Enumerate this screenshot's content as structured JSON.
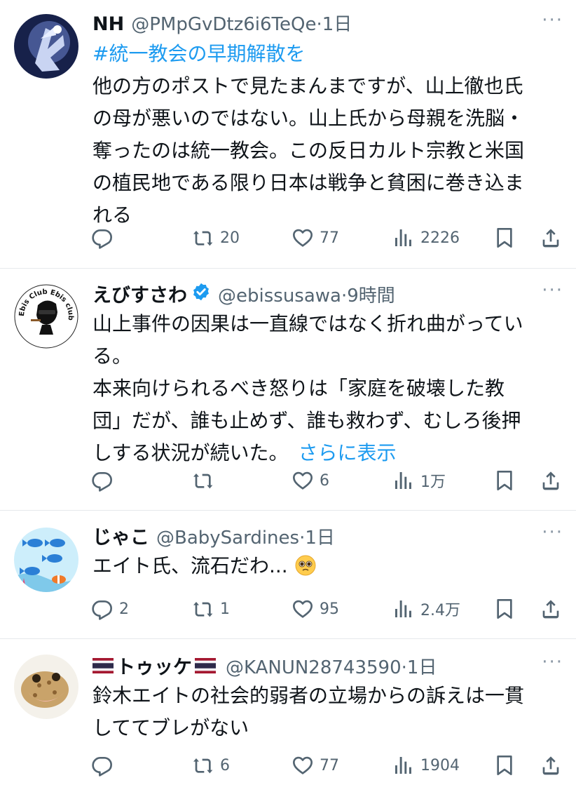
{
  "posts": [
    {
      "name": "NH",
      "handle": "@PMpGvDtz6i6TeQe",
      "dot": "·",
      "time": "1日",
      "hashtag": "#統一教会の早期解散を",
      "lines": [
        "他の方のポストで見たまんまですが、山上徹也氏",
        "の母が悪いのではない。山上氏から母親を洗脳・",
        "奪ったのは統一教会。この反日カルト宗教と米国",
        "の植民地である限り日本は戦争と貧困に巻き込ま",
        "れる"
      ],
      "replies": "",
      "reposts": "20",
      "likes": "77",
      "views": "2226",
      "more": "···"
    },
    {
      "name": "えびすさわ",
      "handle": "@ebissusawa",
      "dot": "·",
      "time": "9時間",
      "lines": [
        "山上事件の因果は一直線ではなく折れ曲がってい",
        "る。",
        "本来向けられるべき怒りは「家庭を破壊した教",
        "団」だが、誰も止めず、誰も救わず、むしろ後押"
      ],
      "last_line": "しする状況が続いた。",
      "show_more": "さらに表示",
      "avatar_text": "Ebis Club Ebis club",
      "replies": "",
      "reposts": "",
      "likes": "6",
      "views": "1万",
      "more": "···"
    },
    {
      "name": "じゃこ",
      "handle": "@BabySardines",
      "dot": "·",
      "time": "1日",
      "text": "エイト氏、流石だわ...",
      "replies": "2",
      "reposts": "1",
      "likes": "95",
      "views": "2.4万",
      "more": "···"
    },
    {
      "name": "トゥッケ",
      "handle": "@KANUN28743590",
      "dot": "·",
      "time": "1日",
      "lines": [
        "鈴木エイトの社会的弱者の立場からの訴えは一貫",
        "しててブレがない"
      ],
      "replies": "",
      "reposts": "6",
      "likes": "77",
      "views": "1904",
      "more": "···"
    }
  ],
  "icons": {
    "reply": "reply-icon",
    "repost": "repost-icon",
    "like": "heart-icon",
    "views": "views-icon",
    "bookmark": "bookmark-icon",
    "share": "share-icon",
    "more": "more-icon"
  },
  "colors": {
    "link": "#1d9bf0",
    "secondary": "#536471",
    "text": "#0f1419",
    "verified": "#1d9bf0"
  }
}
